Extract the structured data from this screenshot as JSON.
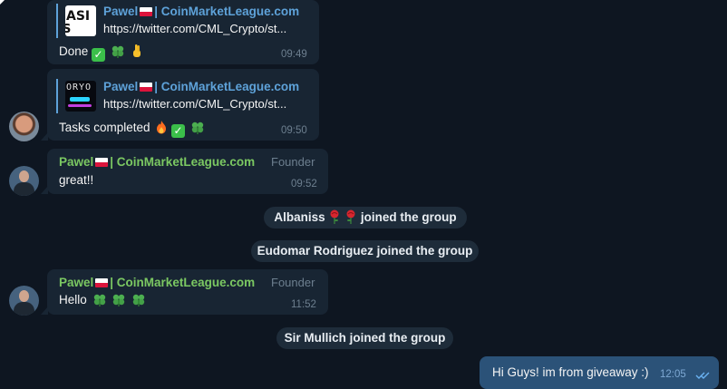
{
  "messages": [
    {
      "reply_name": "Pawel",
      "reply_name_suffix": "| CoinMarketLeague.com",
      "reply_url": "https://twitter.com/CML_Crypto/st...",
      "thumb_text_a": "ASI",
      "thumb_text_b": "S KIN",
      "text": "Done",
      "time": "09:49"
    },
    {
      "reply_name": "Pawel",
      "reply_name_suffix": "| CoinMarketLeague.com",
      "reply_url": "https://twitter.com/CML_Crypto/st...",
      "thumb_text_a": "ORYO",
      "text": "Tasks completed",
      "time": "09:50"
    },
    {
      "sender": "Pawel",
      "sender_suffix": "| CoinMarketLeague.com",
      "role": "Founder",
      "text": "great!!",
      "time": "09:52"
    },
    {
      "sender": "Pawel",
      "sender_suffix": "| CoinMarketLeague.com",
      "role": "Founder",
      "text": "Hello",
      "time": "11:52"
    }
  ],
  "service": {
    "albaniss_name": "Albaniss",
    "albaniss_suffix": "joined the group",
    "eudomar": "Eudomar Rodriguez joined the group",
    "mullich": "Sir Mullich joined the group"
  },
  "outgoing": {
    "text": "Hi Guys! im from  giveaway  :)",
    "time": "12:05",
    "status_icon": "double-check-icon"
  },
  "colors": {
    "background": "#0e1621",
    "bubble_in": "#182533",
    "bubble_out": "#2b5278",
    "sender_name": "#7bc862",
    "reply_name": "#5ea2d9"
  }
}
